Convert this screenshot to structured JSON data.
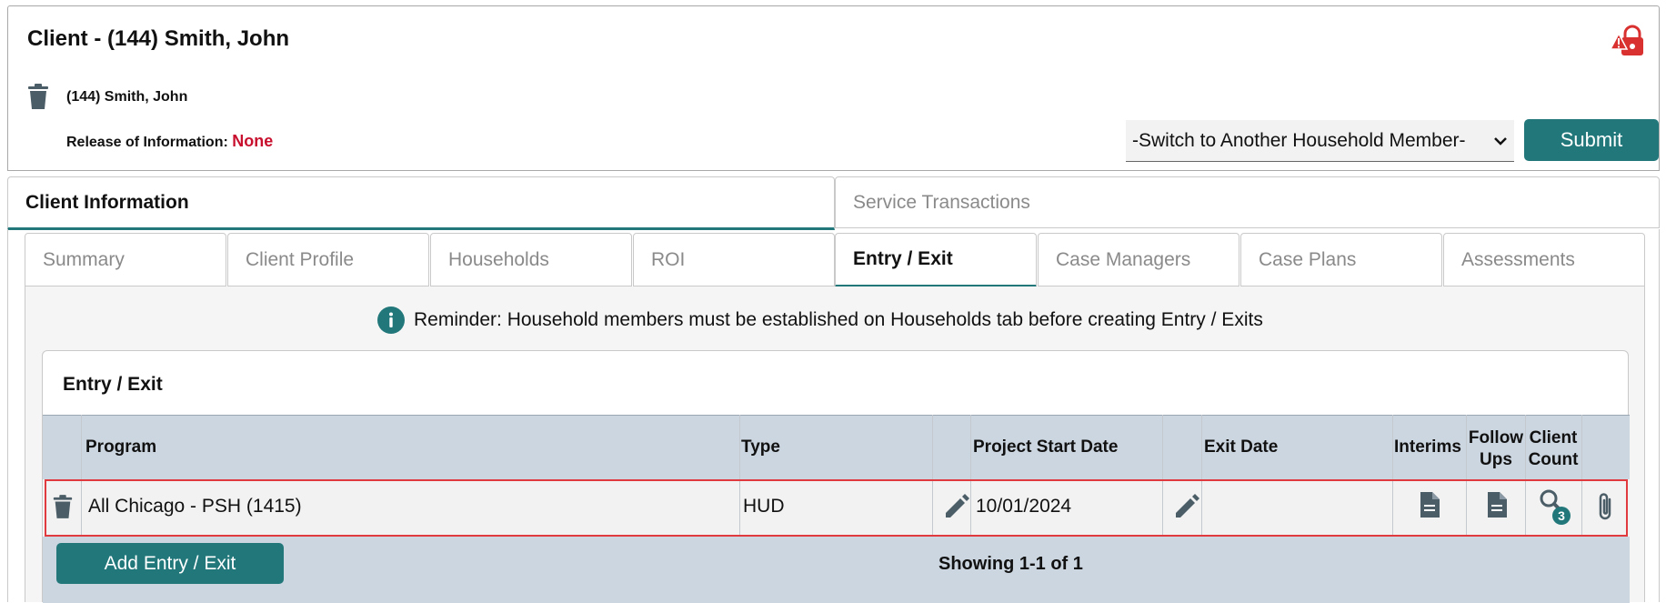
{
  "header": {
    "title": "Client - (144) Smith, John"
  },
  "client": {
    "name": "(144) Smith, John",
    "roi_label": "Release of Information:",
    "roi_value": "None",
    "switch_member_selected": "-Switch to Another Household Member-",
    "submit_label": "Submit"
  },
  "main_tabs": [
    {
      "label": "Client Information"
    },
    {
      "label": "Service Transactions"
    }
  ],
  "sub_tabs": [
    {
      "label": "Summary"
    },
    {
      "label": "Client Profile"
    },
    {
      "label": "Households"
    },
    {
      "label": "ROI"
    },
    {
      "label": "Entry / Exit"
    },
    {
      "label": "Case Managers"
    },
    {
      "label": "Case Plans"
    },
    {
      "label": "Assessments"
    }
  ],
  "reminder": "Reminder: Household members must be established on Households tab before creating Entry / Exits",
  "entry_exit": {
    "section_title": "Entry / Exit",
    "columns": {
      "program": "Program",
      "type": "Type",
      "start_date": "Project Start Date",
      "exit_date": "Exit Date",
      "interims": "Interims",
      "follow_ups_1": "Follow",
      "follow_ups_2": "Ups",
      "client_count_1": "Client",
      "client_count_2": "Count"
    },
    "rows": [
      {
        "program": "All Chicago - PSH (1415)",
        "type": "HUD",
        "start_date": "10/01/2024",
        "exit_date": "",
        "client_count_badge": "3"
      }
    ],
    "add_button": "Add Entry / Exit",
    "pagination": "Showing 1-1 of 1"
  },
  "colors": {
    "accent": "#21777a",
    "none_red": "#c8102e",
    "table_header_bg": "#ccd6e0",
    "highlight_border": "#e0393e",
    "alert_red": "#d93030"
  }
}
